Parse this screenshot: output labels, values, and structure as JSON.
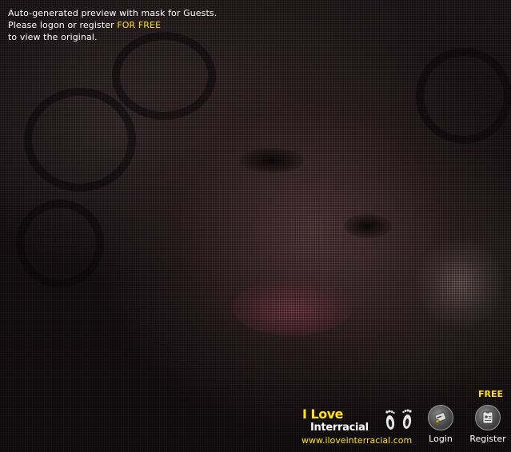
{
  "notice": {
    "line1": "Auto-generated preview with mask for Guests.",
    "line2_prefix": "Please logon or register ",
    "line2_highlight": "FOR FREE",
    "line3": "to view the original."
  },
  "logo": {
    "line1": "I Love",
    "line2": "Interracial",
    "url": "www.iloveinterracial.com"
  },
  "actions": {
    "login_label": "Login",
    "register_label": "Register",
    "free_label": "FREE"
  },
  "icons": {
    "login": "key-card-icon",
    "register": "id-badge-icon",
    "logo_feet": "footprints-icon"
  },
  "colors": {
    "background": "#000000",
    "text": "#ffffff",
    "accent": "#ffe400"
  }
}
